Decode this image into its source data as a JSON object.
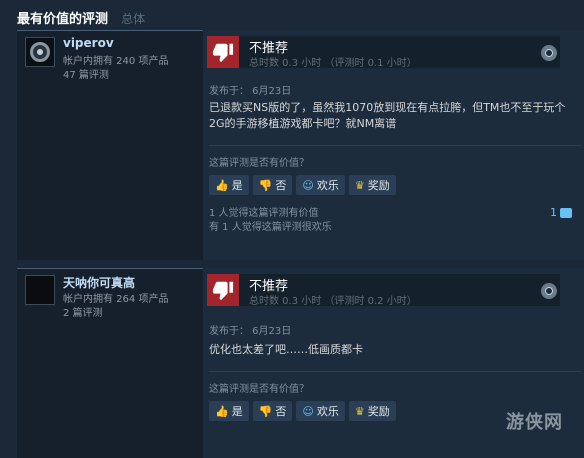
{
  "section": {
    "title": "最有价值的评测",
    "subtitle": "总体"
  },
  "reviews": [
    {
      "author": "viperov",
      "products": "帐户内拥有 240 项产品",
      "review_count": "47 篇评测",
      "verdict": "不推荐",
      "hours": "总时数 0.3 小时 （评测时 0.1 小时）",
      "posted": "发布于：  6月23日",
      "content": "已退款买NS版的了，虽然我1070放到现在有点拉胯，但TM也不至于玩个2G的手游移植游戏都卡吧？就NM离谱",
      "helpful_question": "这篇评测是否有价值？",
      "buttons": {
        "yes": "是",
        "no": "否",
        "funny": "欢乐",
        "award": "奖励"
      },
      "found_helpful": "1 人觉得这篇评测有价值",
      "found_funny": "有 1 人觉得这篇评测很欢乐",
      "comment_count": "1"
    },
    {
      "author": "天呐你可真高",
      "products": "帐户内拥有 264 项产品",
      "review_count": "2 篇评测",
      "verdict": "不推荐",
      "hours": "总时数 0.3 小时 （评测时 0.2 小时）",
      "posted": "发布于：  6月23日",
      "content": "优化也太差了吧……低画质都卡",
      "helpful_question": "这篇评测是否有价值？",
      "buttons": {
        "yes": "是",
        "no": "否",
        "funny": "欢乐",
        "award": "奖励"
      }
    }
  ],
  "watermark": "游侠网",
  "icons": {
    "thumbs_down": "thumbs-down-icon",
    "thumbs_up": "thumbs-up-icon",
    "funny": "smiley-icon",
    "award": "award-icon",
    "platform": "steam-icon",
    "comment": "comment-icon"
  },
  "colors": {
    "background": "#1b2838",
    "not_recommended": "#a3242b",
    "link": "#67c1f5"
  }
}
